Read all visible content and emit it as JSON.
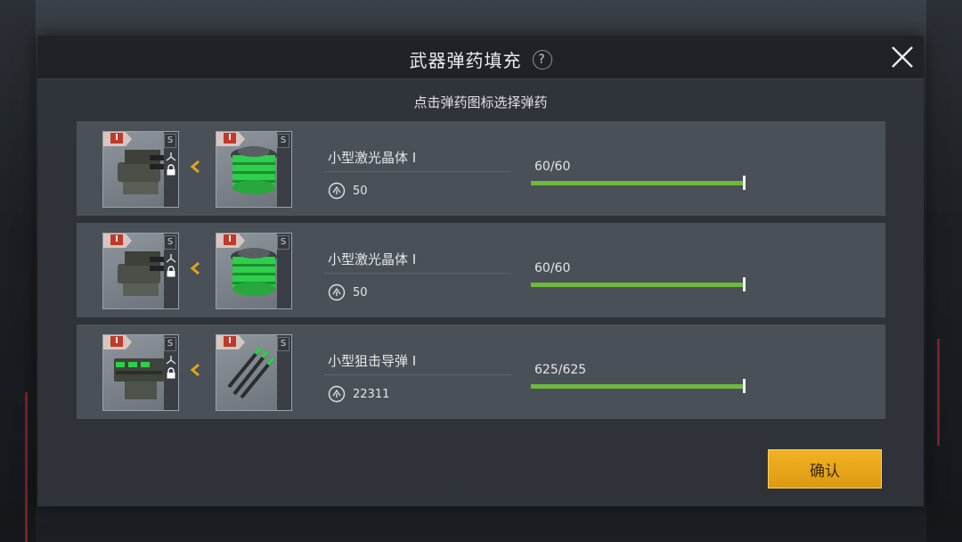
{
  "dialog": {
    "title": "武器弹药填充",
    "help": "?",
    "subtitle": "点击弹药图标选择弹药",
    "confirm_label": "确认"
  },
  "rows": [
    {
      "weapon": {
        "tier": "I",
        "size": "S",
        "icon": "laser-turret-icon"
      },
      "ammo": {
        "tier": "I",
        "size": "S",
        "icon": "crystal-canister-icon"
      },
      "name": "小型激光晶体 I",
      "count": "50",
      "capacity": "60/60",
      "fill": 1.0
    },
    {
      "weapon": {
        "tier": "I",
        "size": "S",
        "icon": "laser-turret-icon"
      },
      "ammo": {
        "tier": "I",
        "size": "S",
        "icon": "crystal-canister-icon"
      },
      "name": "小型激光晶体 I",
      "count": "50",
      "capacity": "60/60",
      "fill": 1.0
    },
    {
      "weapon": {
        "tier": "I",
        "size": "S",
        "icon": "missile-launcher-icon"
      },
      "ammo": {
        "tier": "I",
        "size": "S",
        "icon": "missile-icon"
      },
      "name": "小型狙击导弹 I",
      "count": "22311",
      "capacity": "625/625",
      "fill": 1.0
    }
  ],
  "colors": {
    "accent": "#de9a12",
    "bar": "#6dbb3a",
    "tier": "#c0392b"
  }
}
